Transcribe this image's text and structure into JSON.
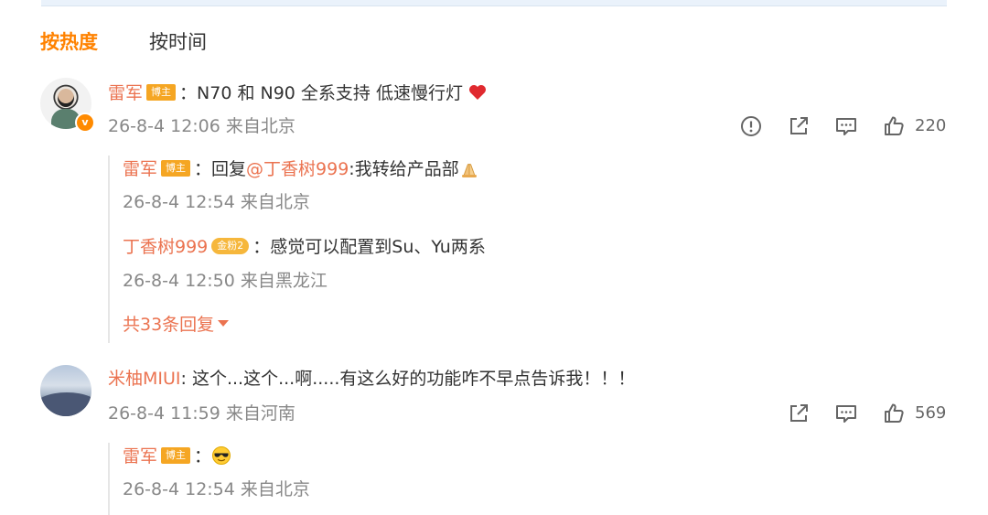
{
  "sort_tabs": {
    "hot": "按热度",
    "time": "按时间"
  },
  "comments": [
    {
      "user": "雷军",
      "tag": "博主",
      "text": "：N70 和 N90 全系支持 低速慢行灯",
      "emoji": "heart-icon",
      "meta": "26-8-4 12:06 来自北京",
      "likes": "220",
      "replies": [
        {
          "user": "雷军",
          "tag": "博主",
          "text_prefix": "：回复",
          "mention": "@丁香树999",
          "text_suffix": ":我转给产品部",
          "emoji": "folded-hands-icon",
          "meta": "26-8-4 12:54 来自北京"
        },
        {
          "user": "丁香树999",
          "tag": "金粉2",
          "text": "：感觉可以配置到Su、Yu两系",
          "meta": "26-8-4 12:50 来自黑龙江"
        }
      ],
      "more_replies": "共33条回复"
    },
    {
      "user": "米柚MIUI",
      "text": ": 这个...这个...啊.....有这么好的功能咋不早点告诉我！！！",
      "meta": "26-8-4 11:59 来自河南",
      "likes": "569",
      "replies": [
        {
          "user": "雷军",
          "tag": "博主",
          "text": "：",
          "emoji": "sunglasses-face-icon",
          "meta": "26-8-4 12:54 来自北京"
        }
      ]
    }
  ],
  "colors": {
    "accent": "#ff8200",
    "username": "#eb7350",
    "meta": "#888888",
    "tag": "#f5a623"
  }
}
